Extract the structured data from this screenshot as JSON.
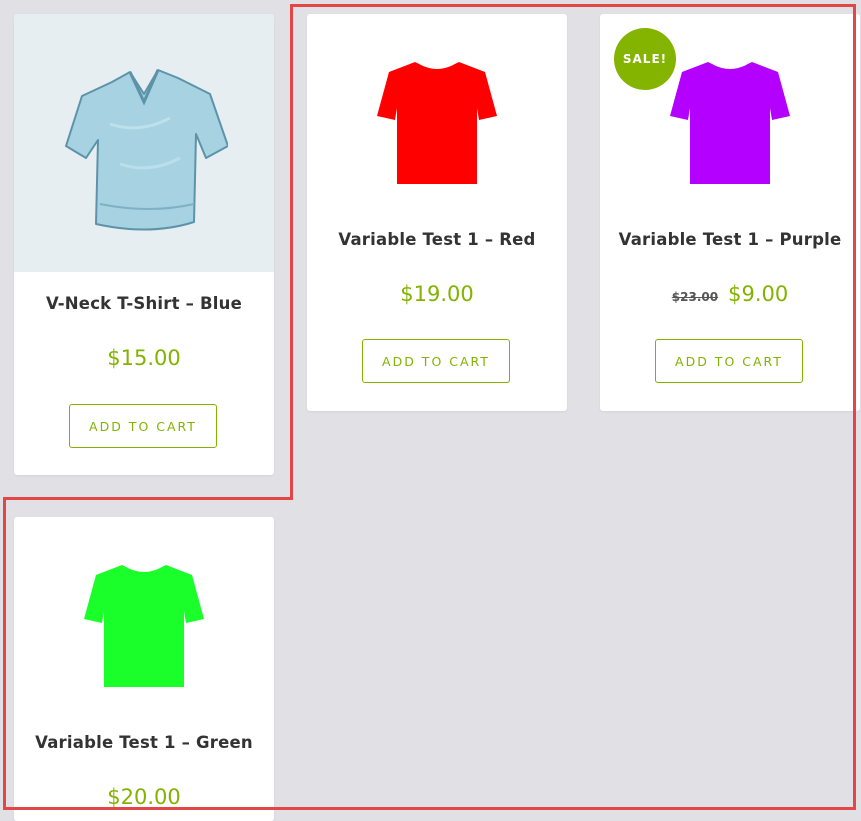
{
  "products": [
    {
      "name": "V-Neck T-Shirt – Blue",
      "price": "$15.00",
      "button": "ADD TO CART",
      "image_icon": "vneck-tshirt-blue-photo",
      "color": "#9fcbdd"
    },
    {
      "name": "Variable Test 1 – Red",
      "price": "$19.00",
      "button": "ADD TO CART",
      "image_icon": "tshirt-red",
      "color": "#ff0000"
    },
    {
      "name": "Variable Test 1 – Purple",
      "old_price": "$23.00",
      "price": "$9.00",
      "sale_badge": "SALE!",
      "button": "ADD TO CART",
      "image_icon": "tshirt-purple",
      "color": "#b300ff"
    },
    {
      "name": "Variable Test 1 – Green",
      "price": "$20.00",
      "image_icon": "tshirt-green",
      "color": "#1aff2a"
    }
  ],
  "colors": {
    "accent": "#83b300",
    "background": "#e1e0e5",
    "highlight_outline": "#e34646"
  }
}
